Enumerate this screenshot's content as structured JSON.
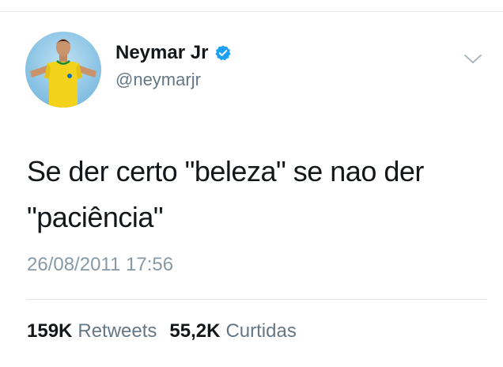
{
  "tweet": {
    "author": {
      "display_name": "Neymar Jr",
      "handle": "@neymarjr",
      "verified": true,
      "verified_icon": "verified-badge-icon",
      "verified_color": "#1da1f2"
    },
    "menu_icon": "chevron-down-icon",
    "text_line1": "Se der certo \"beleza\" se nao der",
    "text_line2": "\"paciência\"",
    "timestamp": "26/08/2011 17:56",
    "stats": {
      "retweets_count": "159K",
      "retweets_label": "Retweets",
      "likes_count": "55,2K",
      "likes_label": "Curtidas"
    }
  },
  "colors": {
    "text_primary": "#14171a",
    "text_secondary": "#657786",
    "divider": "#e3e6e8",
    "accent": "#1da1f2"
  }
}
